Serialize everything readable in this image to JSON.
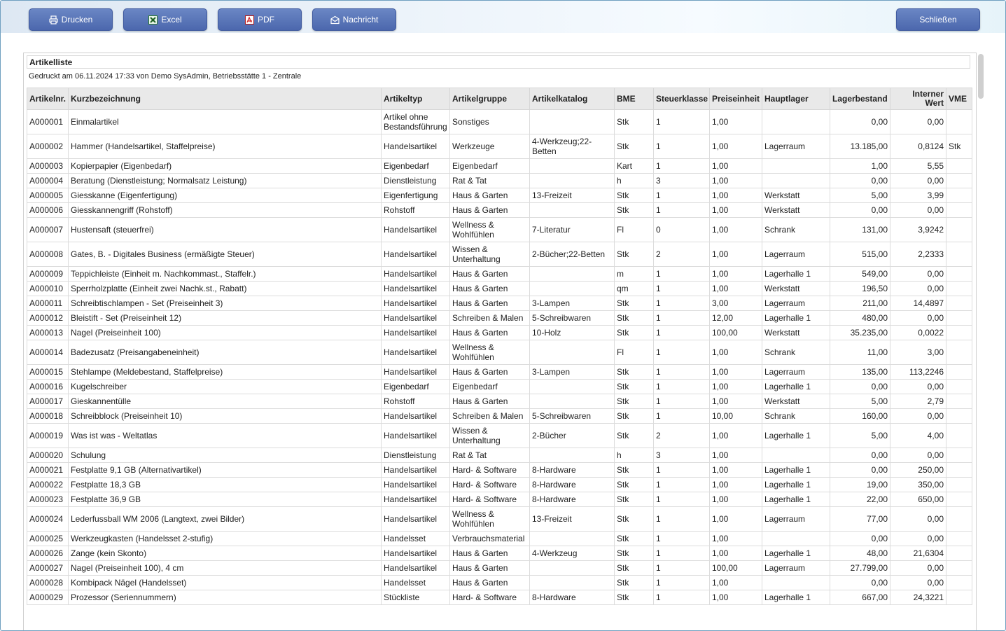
{
  "toolbar": {
    "print_label": "Drucken",
    "excel_label": "Excel",
    "pdf_label": "PDF",
    "message_label": "Nachricht",
    "close_label": "Schließen"
  },
  "report": {
    "title": "Artikelliste",
    "subtitle": "Gedruckt am 06.11.2024 17:33 von Demo SysAdmin, Betriebsstätte 1 - Zentrale"
  },
  "table": {
    "headers": {
      "nr": "Artikelnr.",
      "name": "Kurzbezeichnung",
      "typ": "Artikeltyp",
      "gruppe": "Artikelgruppe",
      "katalog": "Artikelkatalog",
      "bme": "BME",
      "steuer": "Steuerklasse",
      "preis": "Preiseinheit",
      "lager": "Hauptlager",
      "bestand": "Lagerbestand",
      "wert": "Interner Wert",
      "vme": "VME"
    },
    "rows": [
      {
        "nr": "A000001",
        "name": "Einmalartikel",
        "typ": "Artikel ohne Bestandsführung",
        "gruppe": "Sonstiges",
        "katalog": "",
        "bme": "Stk",
        "steuer": "1",
        "preis": "1,00",
        "lager": "",
        "bestand": "0,00",
        "wert": "0,00",
        "vme": "",
        "tall": true
      },
      {
        "nr": "A000002",
        "name": "Hammer (Handelsartikel, Staffelpreise)",
        "typ": "Handelsartikel",
        "gruppe": "Werkzeuge",
        "katalog": "4-Werkzeug;22-Betten",
        "bme": "Stk",
        "steuer": "1",
        "preis": "1,00",
        "lager": "Lagerraum",
        "bestand": "13.185,00",
        "wert": "0,8124",
        "vme": "Stk",
        "tall": true
      },
      {
        "nr": "A000003",
        "name": "Kopierpapier (Eigenbedarf)",
        "typ": "Eigenbedarf",
        "gruppe": "Eigenbedarf",
        "katalog": "",
        "bme": "Kart",
        "steuer": "1",
        "preis": "1,00",
        "lager": "",
        "bestand": "1,00",
        "wert": "5,55",
        "vme": ""
      },
      {
        "nr": "A000004",
        "name": "Beratung (Dienstleistung; Normalsatz Leistung)",
        "typ": "Dienstleistung",
        "gruppe": "Rat & Tat",
        "katalog": "",
        "bme": "h",
        "steuer": "3",
        "preis": "1,00",
        "lager": "",
        "bestand": "0,00",
        "wert": "0,00",
        "vme": ""
      },
      {
        "nr": "A000005",
        "name": "Giesskanne (Eigenfertigung)",
        "typ": "Eigenfertigung",
        "gruppe": "Haus & Garten",
        "katalog": "13-Freizeit",
        "bme": "Stk",
        "steuer": "1",
        "preis": "1,00",
        "lager": "Werkstatt",
        "bestand": "5,00",
        "wert": "3,99",
        "vme": ""
      },
      {
        "nr": "A000006",
        "name": "Giesskannengriff (Rohstoff)",
        "typ": "Rohstoff",
        "gruppe": "Haus & Garten",
        "katalog": "",
        "bme": "Stk",
        "steuer": "1",
        "preis": "1,00",
        "lager": "Werkstatt",
        "bestand": "0,00",
        "wert": "0,00",
        "vme": ""
      },
      {
        "nr": "A000007",
        "name": "Hustensaft (steuerfrei)",
        "typ": "Handelsartikel",
        "gruppe": "Wellness & Wohlfühlen",
        "katalog": "7-Literatur",
        "bme": "Fl",
        "steuer": "0",
        "preis": "1,00",
        "lager": "Schrank",
        "bestand": "131,00",
        "wert": "3,9242",
        "vme": "",
        "tall": true
      },
      {
        "nr": "A000008",
        "name": "Gates, B. - Digitales Business (ermäßigte Steuer)",
        "typ": "Handelsartikel",
        "gruppe": "Wissen & Unterhaltung",
        "katalog": "2-Bücher;22-Betten",
        "bme": "Stk",
        "steuer": "2",
        "preis": "1,00",
        "lager": "Lagerraum",
        "bestand": "515,00",
        "wert": "2,2333",
        "vme": "",
        "tall": true
      },
      {
        "nr": "A000009",
        "name": "Teppichleiste (Einheit m. Nachkommast., Staffelr.)",
        "typ": "Handelsartikel",
        "gruppe": "Haus & Garten",
        "katalog": "",
        "bme": "m",
        "steuer": "1",
        "preis": "1,00",
        "lager": "Lagerhalle 1",
        "bestand": "549,00",
        "wert": "0,00",
        "vme": ""
      },
      {
        "nr": "A000010",
        "name": "Sperrholzplatte (Einheit zwei Nachk.st., Rabatt)",
        "typ": "Handelsartikel",
        "gruppe": "Haus & Garten",
        "katalog": "",
        "bme": "qm",
        "steuer": "1",
        "preis": "1,00",
        "lager": "Werkstatt",
        "bestand": "196,50",
        "wert": "0,00",
        "vme": ""
      },
      {
        "nr": "A000011",
        "name": "Schreibtischlampen - Set (Preiseinheit 3)",
        "typ": "Handelsartikel",
        "gruppe": "Haus & Garten",
        "katalog": "3-Lampen",
        "bme": "Stk",
        "steuer": "1",
        "preis": "3,00",
        "lager": "Lagerraum",
        "bestand": "211,00",
        "wert": "14,4897",
        "vme": ""
      },
      {
        "nr": "A000012",
        "name": "Bleistift - Set (Preiseinheit 12)",
        "typ": "Handelsartikel",
        "gruppe": "Schreiben & Malen",
        "katalog": "5-Schreibwaren",
        "bme": "Stk",
        "steuer": "1",
        "preis": "12,00",
        "lager": "Lagerhalle 1",
        "bestand": "480,00",
        "wert": "0,00",
        "vme": ""
      },
      {
        "nr": "A000013",
        "name": "Nagel (Preiseinheit 100)",
        "typ": "Handelsartikel",
        "gruppe": "Haus & Garten",
        "katalog": "10-Holz",
        "bme": "Stk",
        "steuer": "1",
        "preis": "100,00",
        "lager": "Werkstatt",
        "bestand": "35.235,00",
        "wert": "0,0022",
        "vme": ""
      },
      {
        "nr": "A000014",
        "name": "Badezusatz (Preisangabeneinheit)",
        "typ": "Handelsartikel",
        "gruppe": "Wellness & Wohlfühlen",
        "katalog": "",
        "bme": "Fl",
        "steuer": "1",
        "preis": "1,00",
        "lager": "Schrank",
        "bestand": "11,00",
        "wert": "3,00",
        "vme": "",
        "tall": true
      },
      {
        "nr": "A000015",
        "name": "Stehlampe (Meldebestand, Staffelpreise)",
        "typ": "Handelsartikel",
        "gruppe": "Haus & Garten",
        "katalog": "3-Lampen",
        "bme": "Stk",
        "steuer": "1",
        "preis": "1,00",
        "lager": "Lagerraum",
        "bestand": "135,00",
        "wert": "113,2246",
        "vme": ""
      },
      {
        "nr": "A000016",
        "name": "Kugelschreiber",
        "typ": "Eigenbedarf",
        "gruppe": "Eigenbedarf",
        "katalog": "",
        "bme": "Stk",
        "steuer": "1",
        "preis": "1,00",
        "lager": "Lagerhalle 1",
        "bestand": "0,00",
        "wert": "0,00",
        "vme": ""
      },
      {
        "nr": "A000017",
        "name": "Gieskannentülle",
        "typ": "Rohstoff",
        "gruppe": "Haus & Garten",
        "katalog": "",
        "bme": "Stk",
        "steuer": "1",
        "preis": "1,00",
        "lager": "Werkstatt",
        "bestand": "5,00",
        "wert": "2,79",
        "vme": ""
      },
      {
        "nr": "A000018",
        "name": "Schreibblock (Preiseinheit 10)",
        "typ": "Handelsartikel",
        "gruppe": "Schreiben & Malen",
        "katalog": "5-Schreibwaren",
        "bme": "Stk",
        "steuer": "1",
        "preis": "10,00",
        "lager": "Schrank",
        "bestand": "160,00",
        "wert": "0,00",
        "vme": ""
      },
      {
        "nr": "A000019",
        "name": "Was ist was - Weltatlas",
        "typ": "Handelsartikel",
        "gruppe": "Wissen & Unterhaltung",
        "katalog": "2-Bücher",
        "bme": "Stk",
        "steuer": "2",
        "preis": "1,00",
        "lager": "Lagerhalle 1",
        "bestand": "5,00",
        "wert": "4,00",
        "vme": "",
        "tall": true
      },
      {
        "nr": "A000020",
        "name": "Schulung",
        "typ": "Dienstleistung",
        "gruppe": "Rat & Tat",
        "katalog": "",
        "bme": "h",
        "steuer": "3",
        "preis": "1,00",
        "lager": "",
        "bestand": "0,00",
        "wert": "0,00",
        "vme": ""
      },
      {
        "nr": "A000021",
        "name": "Festplatte 9,1 GB (Alternativartikel)",
        "typ": "Handelsartikel",
        "gruppe": "Hard- & Software",
        "katalog": "8-Hardware",
        "bme": "Stk",
        "steuer": "1",
        "preis": "1,00",
        "lager": "Lagerhalle 1",
        "bestand": "0,00",
        "wert": "250,00",
        "vme": ""
      },
      {
        "nr": "A000022",
        "name": "Festplatte 18,3 GB",
        "typ": "Handelsartikel",
        "gruppe": "Hard- & Software",
        "katalog": "8-Hardware",
        "bme": "Stk",
        "steuer": "1",
        "preis": "1,00",
        "lager": "Lagerhalle 1",
        "bestand": "19,00",
        "wert": "350,00",
        "vme": ""
      },
      {
        "nr": "A000023",
        "name": "Festplatte 36,9 GB",
        "typ": "Handelsartikel",
        "gruppe": "Hard- & Software",
        "katalog": "8-Hardware",
        "bme": "Stk",
        "steuer": "1",
        "preis": "1,00",
        "lager": "Lagerhalle 1",
        "bestand": "22,00",
        "wert": "650,00",
        "vme": ""
      },
      {
        "nr": "A000024",
        "name": "Lederfussball WM 2006 (Langtext, zwei Bilder)",
        "typ": "Handelsartikel",
        "gruppe": "Wellness & Wohlfühlen",
        "katalog": "13-Freizeit",
        "bme": "Stk",
        "steuer": "1",
        "preis": "1,00",
        "lager": "Lagerraum",
        "bestand": "77,00",
        "wert": "0,00",
        "vme": "",
        "tall": true
      },
      {
        "nr": "A000025",
        "name": "Werkzeugkasten (Handelsset 2-stufig)",
        "typ": "Handelsset",
        "gruppe": "Verbrauchsmaterial",
        "katalog": "",
        "bme": "Stk",
        "steuer": "1",
        "preis": "1,00",
        "lager": "",
        "bestand": "0,00",
        "wert": "0,00",
        "vme": ""
      },
      {
        "nr": "A000026",
        "name": "Zange (kein Skonto)",
        "typ": "Handelsartikel",
        "gruppe": "Haus & Garten",
        "katalog": "4-Werkzeug",
        "bme": "Stk",
        "steuer": "1",
        "preis": "1,00",
        "lager": "Lagerhalle 1",
        "bestand": "48,00",
        "wert": "21,6304",
        "vme": ""
      },
      {
        "nr": "A000027",
        "name": "Nagel (Preiseinheit 100), 4 cm",
        "typ": "Handelsartikel",
        "gruppe": "Haus & Garten",
        "katalog": "",
        "bme": "Stk",
        "steuer": "1",
        "preis": "100,00",
        "lager": "Lagerraum",
        "bestand": "27.799,00",
        "wert": "0,00",
        "vme": ""
      },
      {
        "nr": "A000028",
        "name": "Kombipack Nägel (Handelsset)",
        "typ": "Handelsset",
        "gruppe": "Haus & Garten",
        "katalog": "",
        "bme": "Stk",
        "steuer": "1",
        "preis": "1,00",
        "lager": "",
        "bestand": "0,00",
        "wert": "0,00",
        "vme": ""
      },
      {
        "nr": "A000029",
        "name": "Prozessor (Seriennummern)",
        "typ": "Stückliste",
        "gruppe": "Hard- & Software",
        "katalog": "8-Hardware",
        "bme": "Stk",
        "steuer": "1",
        "preis": "1,00",
        "lager": "Lagerhalle 1",
        "bestand": "667,00",
        "wert": "24,3221",
        "vme": ""
      }
    ]
  }
}
